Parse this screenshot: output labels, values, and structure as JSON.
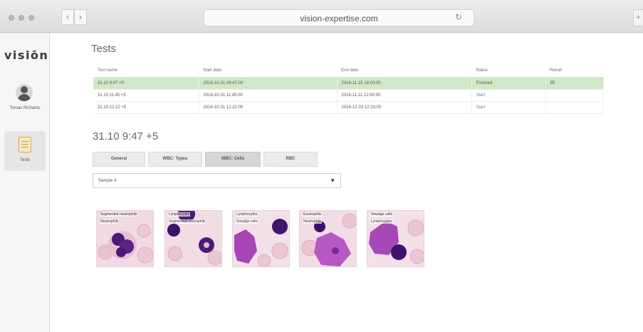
{
  "browser": {
    "url": "vision-expertise.com",
    "back_icon": "chevron-left-icon",
    "forward_icon": "chevron-right-icon",
    "reload_icon": "reload-icon"
  },
  "sidebar": {
    "logo": "visiōn",
    "user_name": "Tomas Richards",
    "nav_tests_label": "Tests"
  },
  "tests": {
    "title": "Tests",
    "columns": [
      "Test name",
      "Start date",
      "End date",
      "Status",
      "Result"
    ],
    "rows": [
      [
        "31.10 9:47 +5",
        "2016-10-31 09:47:00",
        "2016-11-15 18:00:00",
        "Finished",
        "95"
      ],
      [
        "31.10 11:45 +5",
        "2016-10-31 11:45:00",
        "2016-11-11 12:00:00",
        "Start",
        ""
      ],
      [
        "31.10 12:22 +5",
        "2016-10-31 12:22:00",
        "2016-12-03 12:23:00",
        "Start",
        ""
      ]
    ],
    "selected_row": 0,
    "selected_color": "#cfe9c6"
  },
  "detail": {
    "title": "31.10 9:47 +5",
    "tabs": [
      "General",
      "WBC: Types",
      "WBC: Cells",
      "RBC"
    ],
    "active_tab": 2,
    "sample_select": "Sample 4",
    "cells": [
      {
        "label": "Segmented neutrophils",
        "sub": "Neutrophils"
      },
      {
        "label": "Lymphocytes",
        "sub": "Segmented neutrophils"
      },
      {
        "label": "Lymphocytes",
        "sub": "Smudge cells"
      },
      {
        "label": "Eosinophils",
        "sub": "Neutrophils"
      },
      {
        "label": "Smudge cells",
        "sub": "Lymphocytes"
      }
    ]
  }
}
